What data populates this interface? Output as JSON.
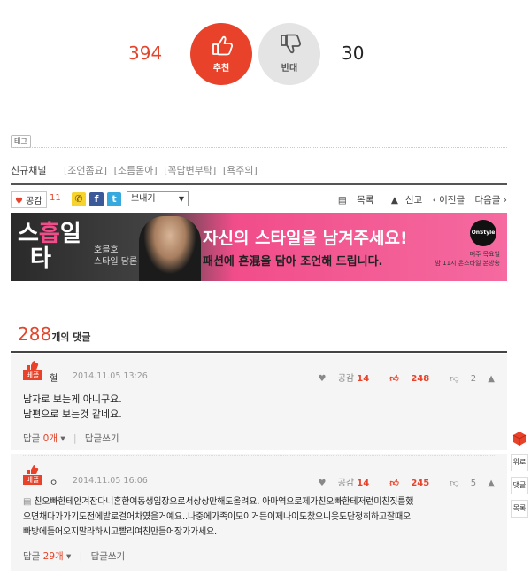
{
  "vote": {
    "up_count": "394",
    "up_label": "추천",
    "down_count": "30",
    "down_label": "반대"
  },
  "tags": {
    "label": "태그"
  },
  "channel": {
    "title": "신규채널",
    "links": [
      "[조언좀요]",
      "[소름돋아]",
      "[꼭답변부탁]",
      "[욕주의]"
    ]
  },
  "action_bar": {
    "like_label": "공감",
    "like_count": "11",
    "send_label": "보내기",
    "list_label": "목록",
    "report_label": "신고",
    "prev_label": "‹ 이전글",
    "next_label": "다음글 ›"
  },
  "banner": {
    "logo_top": "스",
    "logo_pink": "흡",
    "logo_right": "일",
    "logo_bottom": "타",
    "host": "호블호",
    "host_sub": "스타일 담론",
    "headline": "자신의 스타일을 남겨주세요!",
    "subline": "패션에 혼混을 담아 조언해 드립니다.",
    "channel_logo": "OnStyle",
    "schedule_1": "매주 목요일",
    "schedule_2": "밤 11시 온스타일 본방송"
  },
  "comments_header": {
    "count": "288",
    "suffix": "개의 댓글"
  },
  "comments": [
    {
      "best_label": "베플",
      "author": "헐",
      "date": "2014.11.05 13:26",
      "gong_label": "공감",
      "gong_count": "14",
      "up": "248",
      "down": "2",
      "body_1": "남자로 보는게 아니구요.",
      "body_2": "남편으로 보는것 같네요.",
      "reply_label": "답글",
      "reply_count": "0개",
      "write_label": "답글쓰기"
    },
    {
      "best_label": "베플",
      "author": "ㅇ",
      "date": "2014.11.05 16:06",
      "gong_label": "공감",
      "gong_count": "14",
      "up": "245",
      "down": "5",
      "body_1": "친오빠한테안겨잔다니혼한여동생입장으로서상상만해도올려요. 아마역으로제가친오빠한테저런미친짓를했",
      "body_2": "으면채다가가기도전에발로걸어차였을거예요..나중에가족이모이거든이제나이도찼으니옷도단정히하고잘때오",
      "body_3": "빠방에들어오지말라하시고빨리여친만들어장가가세요.",
      "reply_label": "답글",
      "reply_count": "29개",
      "write_label": "답글쓰기"
    }
  ],
  "side_quick": {
    "top": "위로",
    "reply": "댓글",
    "list": "목록"
  },
  "colors": {
    "accent": "#e8432a",
    "banner_pink": "#f14d8a"
  }
}
